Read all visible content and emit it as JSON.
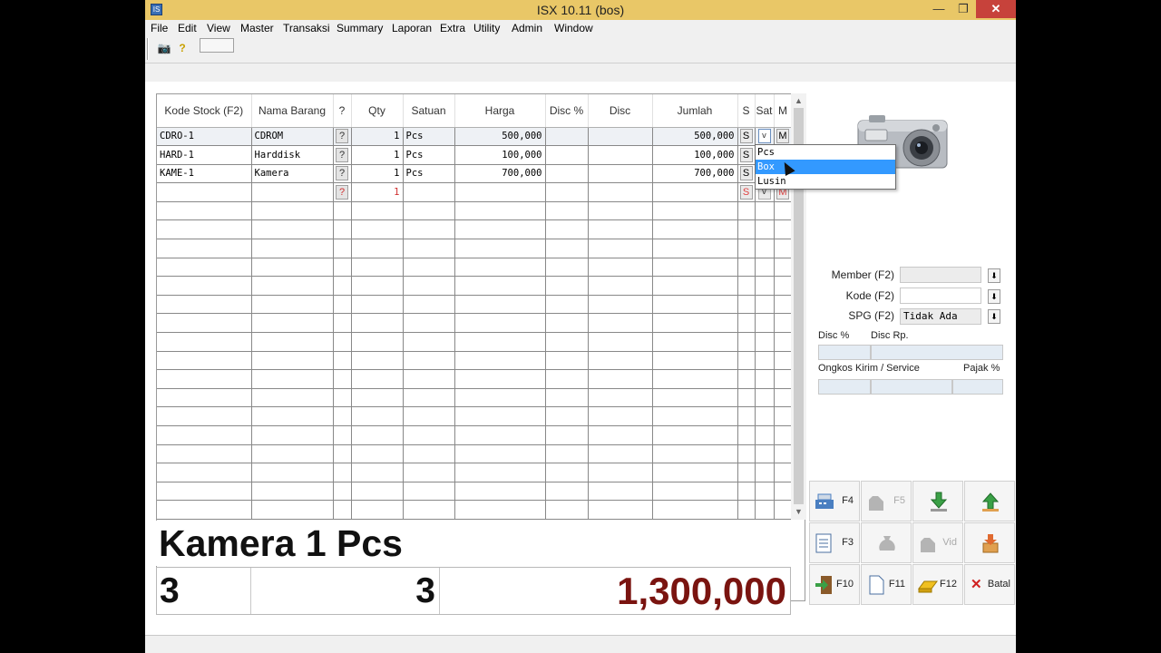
{
  "window": {
    "title": "ISX 10.11 (bos)",
    "icon_text": "IS"
  },
  "menu": [
    "File",
    "Edit",
    "View",
    "Master",
    "Transaksi",
    "Summary",
    "Laporan",
    "Extra",
    "Utility",
    "Admin",
    "Window"
  ],
  "toolbar": {
    "icons": [
      "camera-icon",
      "help-icon"
    ]
  },
  "grid": {
    "headers": [
      "Kode Stock (F2)",
      "Nama Barang",
      "?",
      "Qty",
      "Satuan",
      "Harga",
      "Disc %",
      "Disc",
      "Jumlah",
      "S",
      "Sat",
      "M"
    ],
    "rows": [
      {
        "kode": "CDRO-1",
        "nama": "CDROM",
        "q": "?",
        "qty": "1",
        "satuan": "Pcs",
        "harga": "500,000",
        "disc_pct": "",
        "disc": "",
        "jumlah": "500,000",
        "s": "S",
        "sat": "v",
        "m": "M"
      },
      {
        "kode": "HARD-1",
        "nama": "Harddisk",
        "q": "?",
        "qty": "1",
        "satuan": "Pcs",
        "harga": "100,000",
        "disc_pct": "",
        "disc": "",
        "jumlah": "100,000",
        "s": "S",
        "sat": "",
        "m": ""
      },
      {
        "kode": "KAME-1",
        "nama": "Kamera",
        "q": "?",
        "qty": "1",
        "satuan": "Pcs",
        "harga": "700,000",
        "disc_pct": "",
        "disc": "",
        "jumlah": "700,000",
        "s": "S",
        "sat": "",
        "m": ""
      },
      {
        "kode": "",
        "nama": "",
        "q": "?",
        "qty": "1",
        "satuan": "",
        "harga": "",
        "disc_pct": "",
        "disc": "",
        "jumlah": "",
        "s": "S",
        "sat": "v",
        "m": "M"
      }
    ],
    "empty_rows": 17
  },
  "sat_dropdown": {
    "options": [
      "Pcs",
      "Box",
      "Lusin"
    ],
    "highlighted": "Box"
  },
  "current_item": "Kamera 1 Pcs",
  "totals": {
    "items": "3",
    "qty": "3",
    "amount": "1,300,000"
  },
  "form": {
    "member_label": "Member (F2)",
    "member_value": "",
    "kode_label": "Kode (F2)",
    "kode_value": "",
    "spg_label": "SPG (F2)",
    "spg_value": "Tidak Ada",
    "disc_pct_label": "Disc %",
    "disc_rp_label": "Disc Rp.",
    "ongkos_label": "Ongkos Kirim / Service",
    "pajak_label": "Pajak %"
  },
  "function_buttons": [
    {
      "key": "F4",
      "icon": "cash-register-icon",
      "enabled": true
    },
    {
      "key": "F5",
      "icon": "hand-icon",
      "enabled": false
    },
    {
      "key": "",
      "icon": "download-arrow-icon",
      "enabled": true
    },
    {
      "key": "",
      "icon": "upload-arrow-icon",
      "enabled": true
    },
    {
      "key": "F3",
      "icon": "document-list-icon",
      "enabled": true
    },
    {
      "key": "",
      "icon": "money-bag-icon",
      "enabled": false
    },
    {
      "key": "Vid",
      "icon": "hand-void-icon",
      "enabled": false
    },
    {
      "key": "",
      "icon": "box-arrow-icon",
      "enabled": true
    },
    {
      "key": "F10",
      "icon": "exit-door-icon",
      "enabled": true
    },
    {
      "key": "F11",
      "icon": "blank-page-icon",
      "enabled": true
    },
    {
      "key": "F12",
      "icon": "gold-bar-icon",
      "enabled": true
    },
    {
      "key": "Batal",
      "icon": "close-x-icon",
      "enabled": true
    }
  ],
  "colors": {
    "titlebar": "#e9c767",
    "total_amount": "#7a1410",
    "highlight": "#3399ff"
  }
}
